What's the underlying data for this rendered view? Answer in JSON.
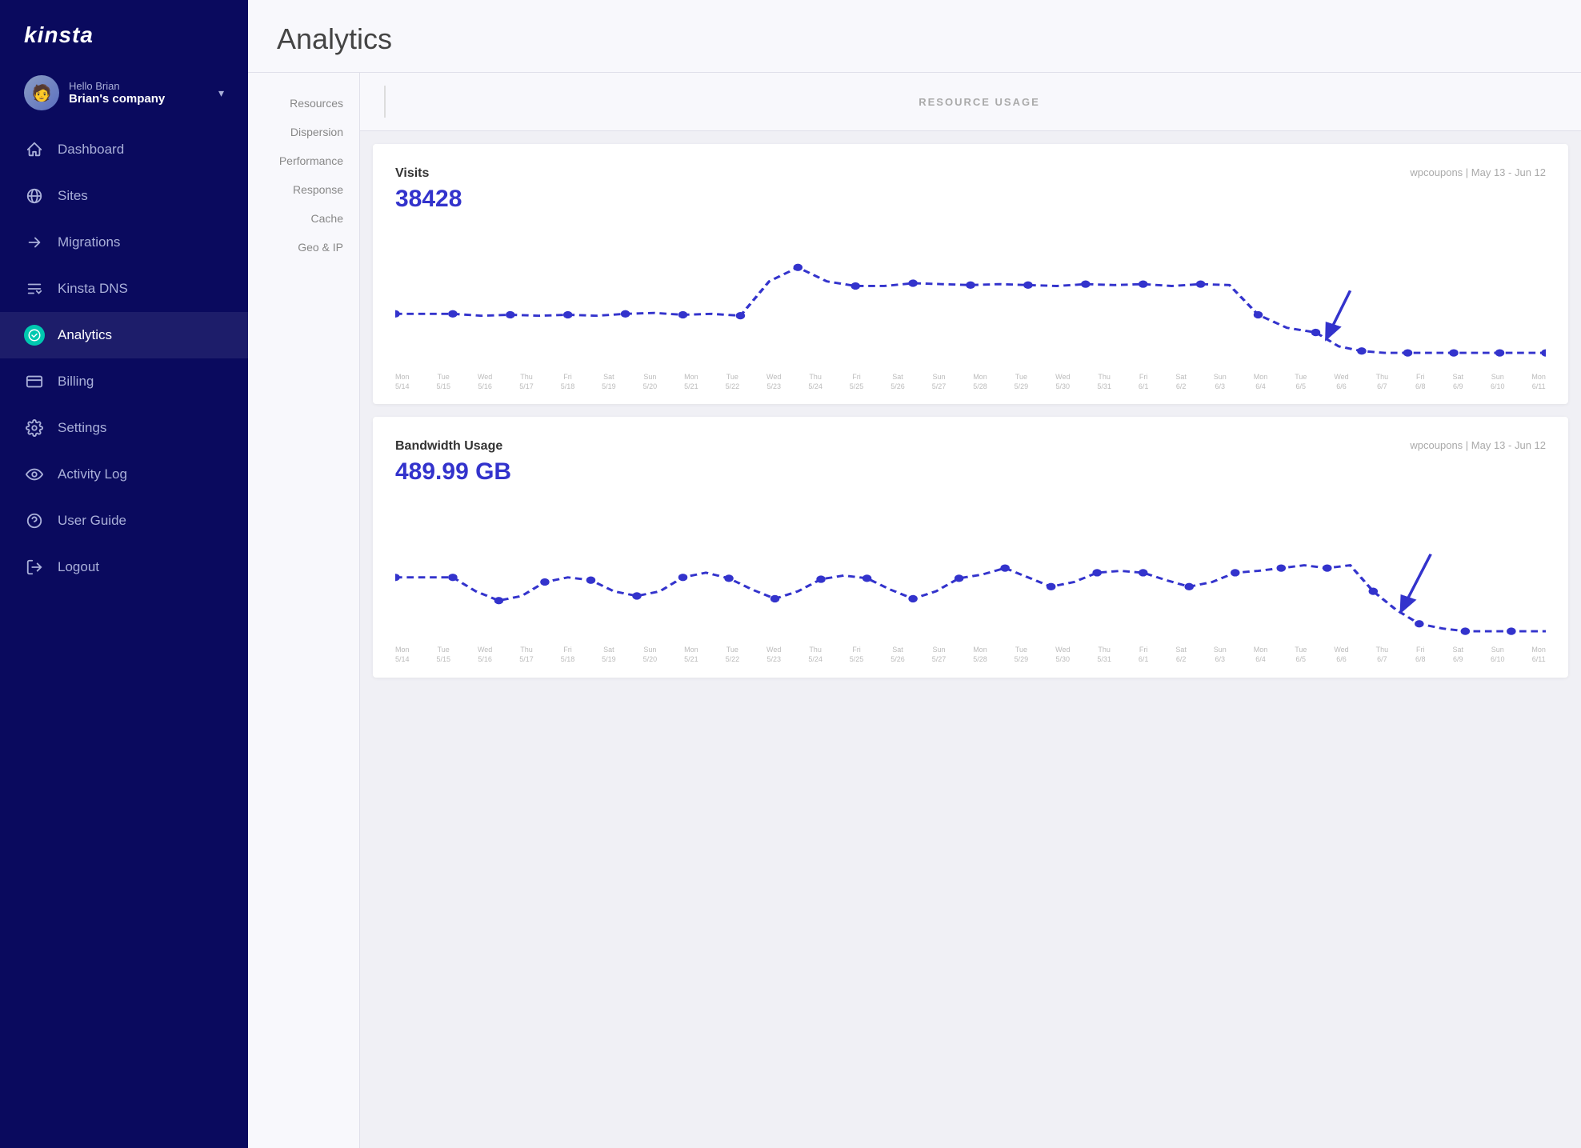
{
  "sidebar": {
    "logo": "kinsta",
    "user": {
      "hello": "Hello Brian",
      "company": "Brian's company"
    },
    "nav": [
      {
        "id": "dashboard",
        "label": "Dashboard",
        "icon": "home"
      },
      {
        "id": "sites",
        "label": "Sites",
        "icon": "globe"
      },
      {
        "id": "migrations",
        "label": "Migrations",
        "icon": "arrow-right"
      },
      {
        "id": "kinsta-dns",
        "label": "Kinsta DNS",
        "icon": "dns"
      },
      {
        "id": "analytics",
        "label": "Analytics",
        "icon": "chart",
        "active": true
      },
      {
        "id": "billing",
        "label": "Billing",
        "icon": "billing"
      },
      {
        "id": "settings",
        "label": "Settings",
        "icon": "gear"
      },
      {
        "id": "activity-log",
        "label": "Activity Log",
        "icon": "eye"
      },
      {
        "id": "user-guide",
        "label": "User Guide",
        "icon": "help"
      },
      {
        "id": "logout",
        "label": "Logout",
        "icon": "logout"
      }
    ]
  },
  "page": {
    "title": "Analytics"
  },
  "sub_nav": {
    "items": [
      {
        "label": "Resources"
      },
      {
        "label": "Dispersion"
      },
      {
        "label": "Performance"
      },
      {
        "label": "Response"
      },
      {
        "label": "Cache"
      },
      {
        "label": "Geo & IP"
      }
    ]
  },
  "resource_usage": {
    "header": "RESOURCE USAGE",
    "charts": [
      {
        "id": "visits",
        "title": "Visits",
        "value": "38428",
        "subtitle": "wpcoupons | May 13 - Jun 12"
      },
      {
        "id": "bandwidth",
        "title": "Bandwidth Usage",
        "value": "489.99 GB",
        "subtitle": "wpcoupons | May 13 - Jun 12"
      }
    ]
  },
  "chart_dates": [
    "Mon 5/14",
    "Tue 5/15",
    "Wed 5/16",
    "Thu 5/17",
    "Fri 5/18",
    "Sat 5/19",
    "Sun 5/20",
    "Mon 5/21",
    "Tue 5/22",
    "Wed 5/23",
    "Thu 5/24",
    "Fri 5/25",
    "Sat 5/26",
    "Sun 5/27",
    "Mon 5/28",
    "Tue 5/29",
    "Wed 5/30",
    "Thu 5/31",
    "Fri 6/1",
    "Sat 6/2",
    "Sun 6/3",
    "Mon 6/4",
    "Tue 6/5",
    "Wed 6/6",
    "Thu 6/7",
    "Fri 6/8",
    "Sat 6/9",
    "Sun 6/10",
    "Mon 6/11"
  ]
}
